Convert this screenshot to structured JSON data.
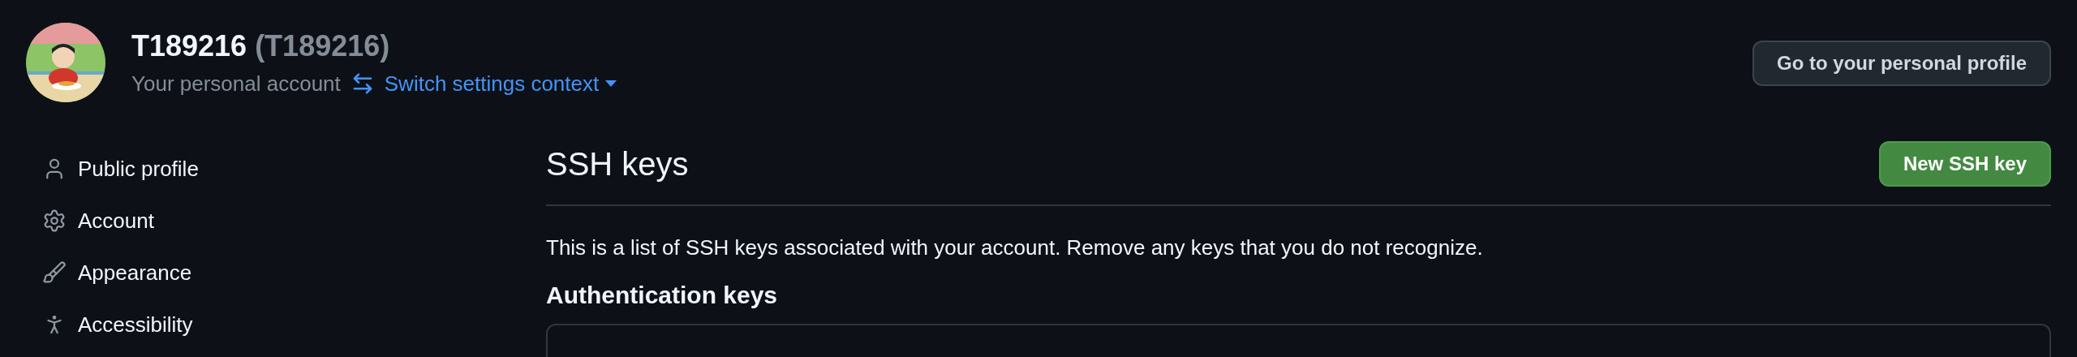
{
  "header": {
    "name": "T189216",
    "login": "(T189216)",
    "subtitle": "Your personal account",
    "switch_link": "Switch settings context",
    "profile_button": "Go to your personal profile"
  },
  "sidebar": {
    "items": [
      {
        "label": "Public profile",
        "selected": false
      },
      {
        "label": "Account",
        "selected": false
      },
      {
        "label": "Appearance",
        "selected": false
      },
      {
        "label": "Accessibility",
        "selected": false
      }
    ]
  },
  "main": {
    "title": "SSH keys",
    "new_button": "New SSH key",
    "description": "This is a list of SSH keys associated with your account. Remove any keys that you do not recognize.",
    "section_title": "Authentication keys"
  }
}
